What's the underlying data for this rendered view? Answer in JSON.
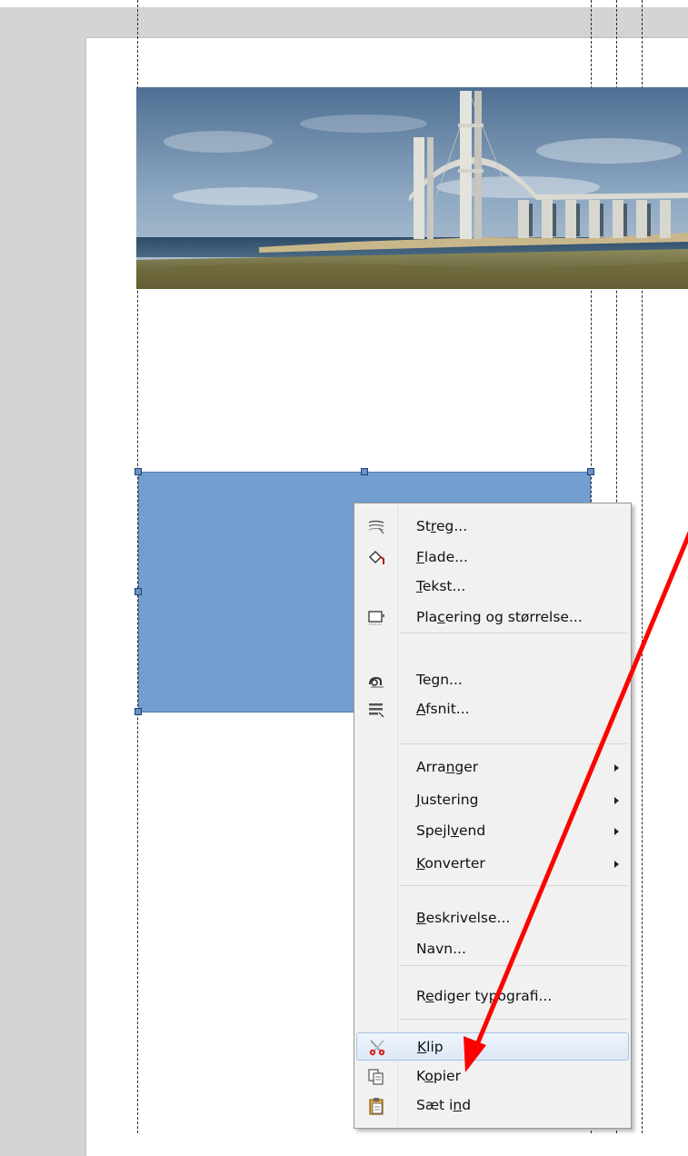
{
  "context_menu": {
    "items": [
      {
        "name": "menu-item-streg",
        "icon": "line-style-icon",
        "pre": "St",
        "acc": "r",
        "post": "eg...",
        "submenu": false
      },
      {
        "name": "menu-item-flade",
        "icon": "paint-bucket-icon",
        "pre": "",
        "acc": "F",
        "post": "lade...",
        "submenu": false
      },
      {
        "name": "menu-item-tekst",
        "icon": "",
        "pre": "",
        "acc": "T",
        "post": "ekst...",
        "submenu": false
      },
      {
        "name": "menu-item-placering",
        "icon": "position-size-icon",
        "pre": "Pla",
        "acc": "c",
        "post": "ering og størrelse...",
        "submenu": false
      },
      {
        "name": "menu-item-tegn",
        "icon": "character-icon",
        "pre": "Te",
        "acc": "g",
        "post": "n...",
        "submenu": false
      },
      {
        "name": "menu-item-afsnit",
        "icon": "paragraph-icon",
        "pre": "",
        "acc": "A",
        "post": "fsnit...",
        "submenu": false
      },
      {
        "name": "menu-item-arranger",
        "icon": "",
        "pre": "Arra",
        "acc": "n",
        "post": "ger",
        "submenu": true
      },
      {
        "name": "menu-item-justering",
        "icon": "",
        "pre": "",
        "acc": "J",
        "post": "ustering",
        "submenu": true
      },
      {
        "name": "menu-item-spejlvend",
        "icon": "",
        "pre": "Spejl",
        "acc": "v",
        "post": "end",
        "submenu": true
      },
      {
        "name": "menu-item-konverter",
        "icon": "",
        "pre": "",
        "acc": "K",
        "post": "onverter",
        "submenu": true
      },
      {
        "name": "menu-item-beskrivelse",
        "icon": "",
        "pre": "",
        "acc": "B",
        "post": "eskrivelse...",
        "submenu": false
      },
      {
        "name": "menu-item-navn",
        "icon": "",
        "pre": "Navn...",
        "acc": "",
        "post": "",
        "submenu": false
      },
      {
        "name": "menu-item-rediger-typografi",
        "icon": "",
        "pre": "R",
        "acc": "e",
        "post": "diger typografi...",
        "submenu": false
      },
      {
        "name": "menu-item-klip",
        "icon": "scissors-icon",
        "pre": "",
        "acc": "K",
        "post": "lip",
        "submenu": false,
        "highlighted": true
      },
      {
        "name": "menu-item-kopier",
        "icon": "copy-icon",
        "pre": "K",
        "acc": "o",
        "post": "pier",
        "submenu": false
      },
      {
        "name": "menu-item-saet-ind",
        "icon": "paste-icon",
        "pre": "Sæt i",
        "acc": "n",
        "post": "d",
        "submenu": false
      }
    ]
  },
  "colors": {
    "canvas_background": "#d4d4d4",
    "page": "#ffffff",
    "shape_fill": "#729fcf",
    "menu_background": "#f1f1f1",
    "menu_highlight": "#dde8f6",
    "annotation_arrow": "#ff0000"
  },
  "canvas": {
    "image": "bridge-photo",
    "shape": "blue-rectangle",
    "annotation": "red-arrow-pointing-to-klip"
  }
}
